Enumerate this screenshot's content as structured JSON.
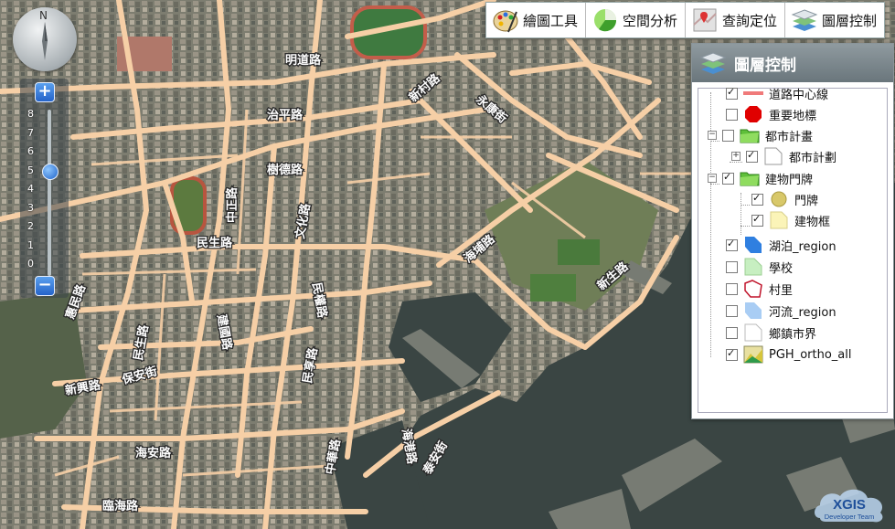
{
  "compass": {
    "north_label": "N"
  },
  "zoom": {
    "plus_label": "+",
    "minus_label": "−",
    "levels": [
      "8",
      "7",
      "6",
      "5",
      "4",
      "3",
      "2",
      "1",
      "0"
    ],
    "current_level": 5
  },
  "toolbar": {
    "items": [
      {
        "label": "繪圖工具",
        "icon": "palette-icon"
      },
      {
        "label": "空間分析",
        "icon": "analysis-icon"
      },
      {
        "label": "查詢定位",
        "icon": "locate-icon"
      },
      {
        "label": "圖層控制",
        "icon": "layers-icon"
      }
    ]
  },
  "panel": {
    "title": "圖層控制",
    "layers": [
      {
        "label": "道路中心線",
        "checked": true,
        "symbol": "road-line-icon",
        "color": "#f07a7a"
      },
      {
        "label": "重要地標",
        "checked": false,
        "symbol": "red-octagon-icon",
        "color": "#e00000"
      },
      {
        "label": "都市計畫",
        "checked": false,
        "symbol": "folder-icon",
        "color": "#5fbf3a"
      },
      {
        "label": "都市計劃",
        "checked": true,
        "symbol": "page-icon",
        "color": "#ffffff"
      },
      {
        "label": "建物門牌",
        "checked": true,
        "symbol": "folder-icon",
        "color": "#5fbf3a"
      },
      {
        "label": "門牌",
        "checked": true,
        "symbol": "yellow-circle-icon",
        "color": "#d8c86a"
      },
      {
        "label": "建物框",
        "checked": true,
        "symbol": "yellow-polygon-icon",
        "color": "#fbf4b8"
      },
      {
        "label": "湖泊_region",
        "checked": true,
        "symbol": "blue-polygon-icon",
        "color": "#2f7fe0"
      },
      {
        "label": "學校",
        "checked": false,
        "symbol": "green-polygon-icon",
        "color": "#c7efc1"
      },
      {
        "label": "村里",
        "checked": false,
        "symbol": "red-outline-polygon-icon",
        "color": "#c0142b"
      },
      {
        "label": "河流_region",
        "checked": false,
        "symbol": "lightblue-polygon-icon",
        "color": "#a9cdf4"
      },
      {
        "label": "鄉鎮市界",
        "checked": false,
        "symbol": "page-icon",
        "color": "#ffffff"
      },
      {
        "label": "PGH_ortho_all",
        "checked": true,
        "symbol": "raster-icon",
        "color": "#d6c53a"
      }
    ]
  },
  "map": {
    "road_labels": [
      "明道路",
      "治平路",
      "新村路",
      "永康街",
      "樹德路",
      "中正路",
      "文化路",
      "民生路",
      "民權路",
      "建國路",
      "海埔路",
      "民生路",
      "新生路",
      "新興路",
      "惠民路",
      "民享路",
      "保安街",
      "海安路",
      "臨海路",
      "泰安街",
      "海港路",
      "中華路"
    ],
    "colors": {
      "land": "#5f6657",
      "water": "#3a4543",
      "road": "#f6cfa6"
    }
  },
  "watermark": {
    "title": "XGIS",
    "subtitle": "Developer Team"
  }
}
